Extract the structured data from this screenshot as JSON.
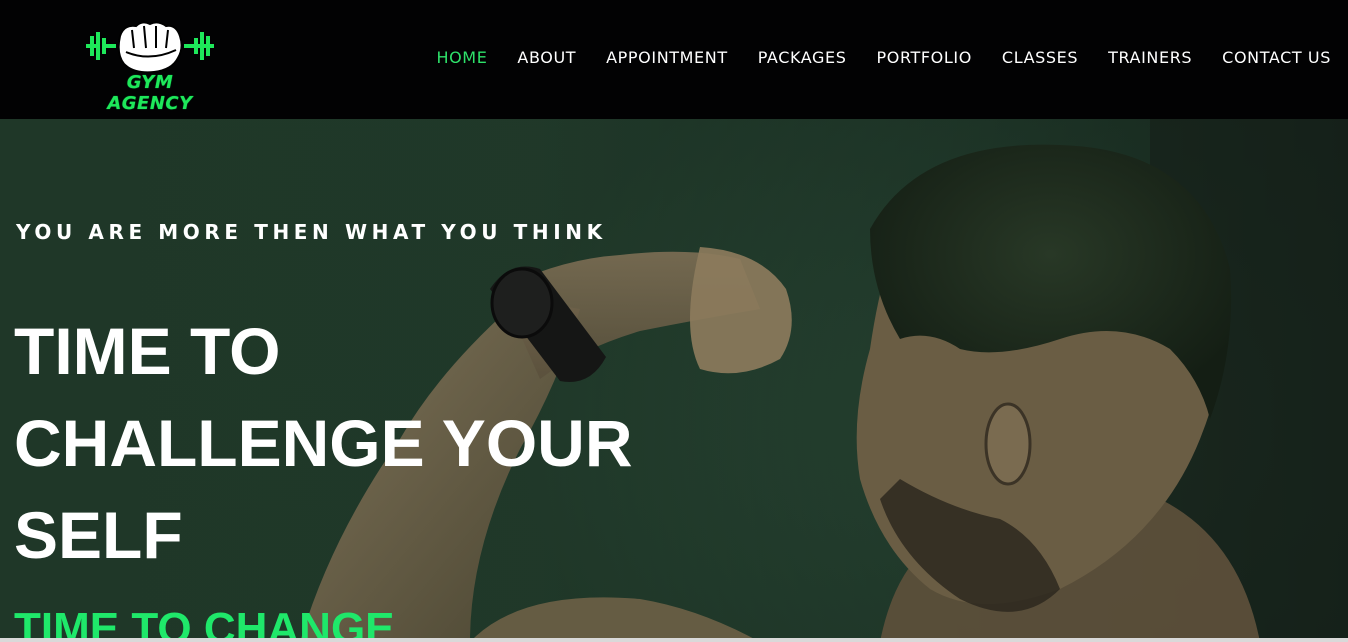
{
  "logo": {
    "text": "GYM AGENCY",
    "accent": "#1ee85a"
  },
  "nav": {
    "items": [
      {
        "label": "HOME",
        "active": true
      },
      {
        "label": "ABOUT",
        "active": false
      },
      {
        "label": "APPOINTMENT",
        "active": false
      },
      {
        "label": "PACKAGES",
        "active": false
      },
      {
        "label": "PORTFOLIO",
        "active": false
      },
      {
        "label": "CLASSES",
        "active": false
      },
      {
        "label": "TRAINERS",
        "active": false
      },
      {
        "label": "CONTACT US",
        "active": false
      }
    ],
    "active_color": "#2ee26a"
  },
  "hero": {
    "tagline": "YOU ARE MORE THEN WHAT YOU THINK",
    "title_lines": [
      "TIME TO",
      "CHALLENGE YOUR",
      "SELF"
    ],
    "subtitle": "TIME TO CHANGE",
    "background_color": "#2a4a36",
    "subtitle_color": "#1fe86a"
  }
}
